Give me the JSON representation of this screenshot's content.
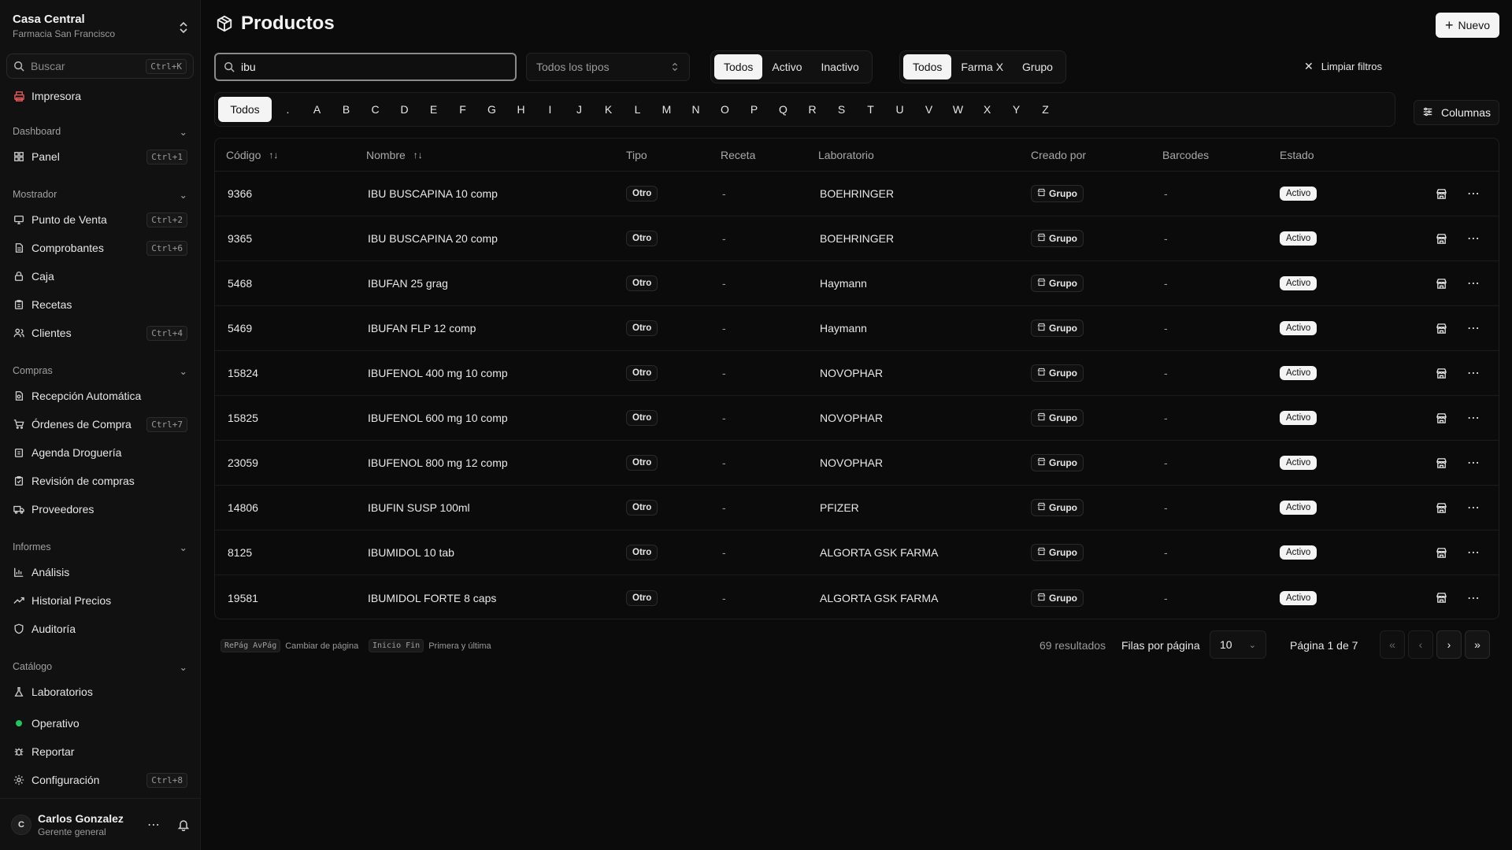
{
  "org": {
    "name": "Casa Central",
    "subtitle": "Farmacia San Francisco"
  },
  "search": {
    "placeholder": "Buscar",
    "shortcut": "Ctrl+K"
  },
  "sidebar": {
    "top_item": {
      "label": "Impresora",
      "icon": "printer-icon"
    },
    "sections": [
      {
        "title": "Dashboard",
        "items": [
          {
            "label": "Panel",
            "shortcut": "Ctrl+1",
            "icon": "grid-icon"
          }
        ]
      },
      {
        "title": "Mostrador",
        "items": [
          {
            "label": "Punto de Venta",
            "shortcut": "Ctrl+2",
            "icon": "monitor-icon"
          },
          {
            "label": "Comprobantes",
            "shortcut": "Ctrl+6",
            "icon": "receipt-icon"
          },
          {
            "label": "Caja",
            "shortcut": "",
            "icon": "lock-icon"
          },
          {
            "label": "Recetas",
            "shortcut": "",
            "icon": "clipboard-icon"
          },
          {
            "label": "Clientes",
            "shortcut": "Ctrl+4",
            "icon": "users-icon"
          }
        ]
      },
      {
        "title": "Compras",
        "items": [
          {
            "label": "Recepción Automática",
            "shortcut": "",
            "icon": "file-scan-icon"
          },
          {
            "label": "Órdenes de Compra",
            "shortcut": "Ctrl+7",
            "icon": "cart-icon"
          },
          {
            "label": "Agenda Droguería",
            "shortcut": "",
            "icon": "calendar-icon"
          },
          {
            "label": "Revisión de compras",
            "shortcut": "",
            "icon": "clipboard-check-icon"
          },
          {
            "label": "Proveedores",
            "shortcut": "",
            "icon": "truck-icon"
          }
        ]
      },
      {
        "title": "Informes",
        "items": [
          {
            "label": "Análisis",
            "shortcut": "",
            "icon": "bar-chart-icon"
          },
          {
            "label": "Historial Precios",
            "shortcut": "",
            "icon": "trend-icon"
          },
          {
            "label": "Auditoría",
            "shortcut": "",
            "icon": "shield-icon"
          }
        ]
      },
      {
        "title": "Catálogo",
        "items": [
          {
            "label": "Laboratorios",
            "shortcut": "",
            "icon": "flask-icon"
          }
        ]
      }
    ],
    "bottom_items": [
      {
        "label": "Operativo",
        "shortcut": "",
        "icon": "status-dot-icon"
      },
      {
        "label": "Reportar",
        "shortcut": "",
        "icon": "bug-icon"
      },
      {
        "label": "Configuración",
        "shortcut": "Ctrl+8",
        "icon": "gear-icon"
      }
    ]
  },
  "user": {
    "initial": "C",
    "name": "Carlos Gonzalez",
    "role": "Gerente general"
  },
  "page": {
    "title": "Productos",
    "new_label": "Nuevo"
  },
  "filters": {
    "search_value": "ibu",
    "type_placeholder": "Todos los tipos",
    "status_options": [
      "Todos",
      "Activo",
      "Inactivo"
    ],
    "status_selected": "Todos",
    "origin_options": [
      "Todos",
      "Farma X",
      "Grupo"
    ],
    "origin_selected": "Todos",
    "clear_label": "Limpiar filtros",
    "letters": [
      "Todos",
      ".",
      "A",
      "B",
      "C",
      "D",
      "E",
      "F",
      "G",
      "H",
      "I",
      "J",
      "K",
      "L",
      "M",
      "N",
      "O",
      "P",
      "Q",
      "R",
      "S",
      "T",
      "U",
      "V",
      "W",
      "X",
      "Y",
      "Z"
    ],
    "letter_selected": "Todos",
    "columns_label": "Columnas"
  },
  "table": {
    "headers": [
      "Código",
      "Nombre",
      "Tipo",
      "Receta",
      "Laboratorio",
      "Creado por",
      "Barcodes",
      "Estado"
    ],
    "rows": [
      {
        "code": "9366",
        "name": "IBU BUSCAPINA 10 comp",
        "type": "Otro",
        "receta": "-",
        "lab": "BOEHRINGER",
        "created_by": "Grupo",
        "barcodes": "-",
        "status": "Activo"
      },
      {
        "code": "9365",
        "name": "IBU BUSCAPINA 20 comp",
        "type": "Otro",
        "receta": "-",
        "lab": "BOEHRINGER",
        "created_by": "Grupo",
        "barcodes": "-",
        "status": "Activo"
      },
      {
        "code": "5468",
        "name": "IBUFAN 25 grag",
        "type": "Otro",
        "receta": "-",
        "lab": "Haymann",
        "created_by": "Grupo",
        "barcodes": "-",
        "status": "Activo"
      },
      {
        "code": "5469",
        "name": "IBUFAN FLP 12 comp",
        "type": "Otro",
        "receta": "-",
        "lab": "Haymann",
        "created_by": "Grupo",
        "barcodes": "-",
        "status": "Activo"
      },
      {
        "code": "15824",
        "name": "IBUFENOL 400 mg 10 comp",
        "type": "Otro",
        "receta": "-",
        "lab": "NOVOPHAR",
        "created_by": "Grupo",
        "barcodes": "-",
        "status": "Activo"
      },
      {
        "code": "15825",
        "name": "IBUFENOL 600 mg 10 comp",
        "type": "Otro",
        "receta": "-",
        "lab": "NOVOPHAR",
        "created_by": "Grupo",
        "barcodes": "-",
        "status": "Activo"
      },
      {
        "code": "23059",
        "name": "IBUFENOL 800 mg 12 comp",
        "type": "Otro",
        "receta": "-",
        "lab": "NOVOPHAR",
        "created_by": "Grupo",
        "barcodes": "-",
        "status": "Activo"
      },
      {
        "code": "14806",
        "name": "IBUFIN SUSP 100ml",
        "type": "Otro",
        "receta": "-",
        "lab": "PFIZER",
        "created_by": "Grupo",
        "barcodes": "-",
        "status": "Activo"
      },
      {
        "code": "8125",
        "name": "IBUMIDOL 10 tab",
        "type": "Otro",
        "receta": "-",
        "lab": "ALGORTA GSK FARMA",
        "created_by": "Grupo",
        "barcodes": "-",
        "status": "Activo"
      },
      {
        "code": "19581",
        "name": "IBUMIDOL FORTE 8 caps",
        "type": "Otro",
        "receta": "-",
        "lab": "ALGORTA GSK FARMA",
        "created_by": "Grupo",
        "barcodes": "-",
        "status": "Activo"
      }
    ]
  },
  "pagination": {
    "hint1_keys": "RePág AvPág",
    "hint1_text": "Cambiar de página",
    "hint2_keys": "Inicio Fin",
    "hint2_text": "Primera y última",
    "results": "69 resultados",
    "rows_label": "Filas por página",
    "rows_value": "10",
    "page_label": "Página 1 de 7"
  }
}
